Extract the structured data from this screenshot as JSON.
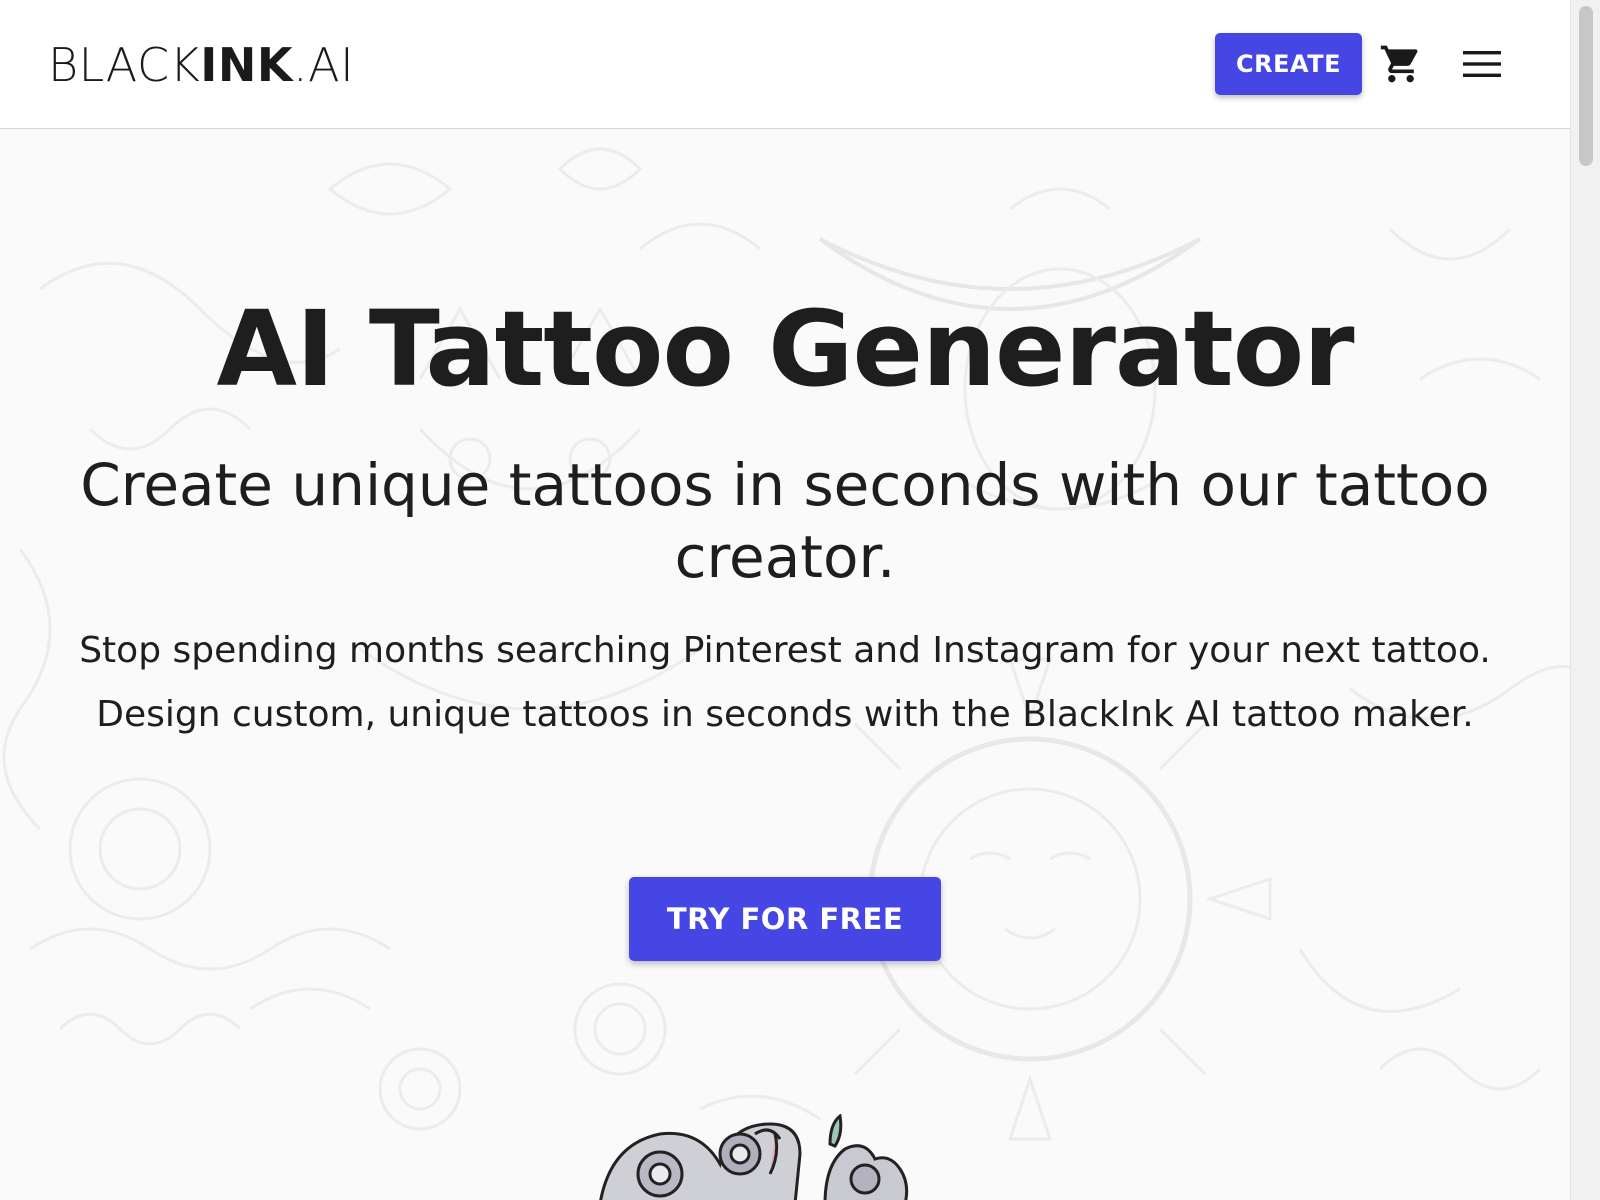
{
  "header": {
    "logo_light_start": "BLACK",
    "logo_bold": "INK",
    "logo_light_end": ".AI",
    "create_label": "CREATE",
    "cart_icon": "shopping-cart-icon",
    "menu_icon": "hamburger-menu-icon"
  },
  "hero": {
    "title": "AI Tattoo Generator",
    "subtitle": "Create unique tattoos in seconds with our tattoo creator.",
    "description": "Stop spending months searching Pinterest and Instagram for your next tattoo. Design custom, unique tattoos in seconds with the BlackInk AI tattoo maker.",
    "cta_label": "TRY FOR FREE"
  },
  "colors": {
    "accent": "#4546e4",
    "text": "#1e1e1e",
    "background": "#f7f7f7"
  }
}
